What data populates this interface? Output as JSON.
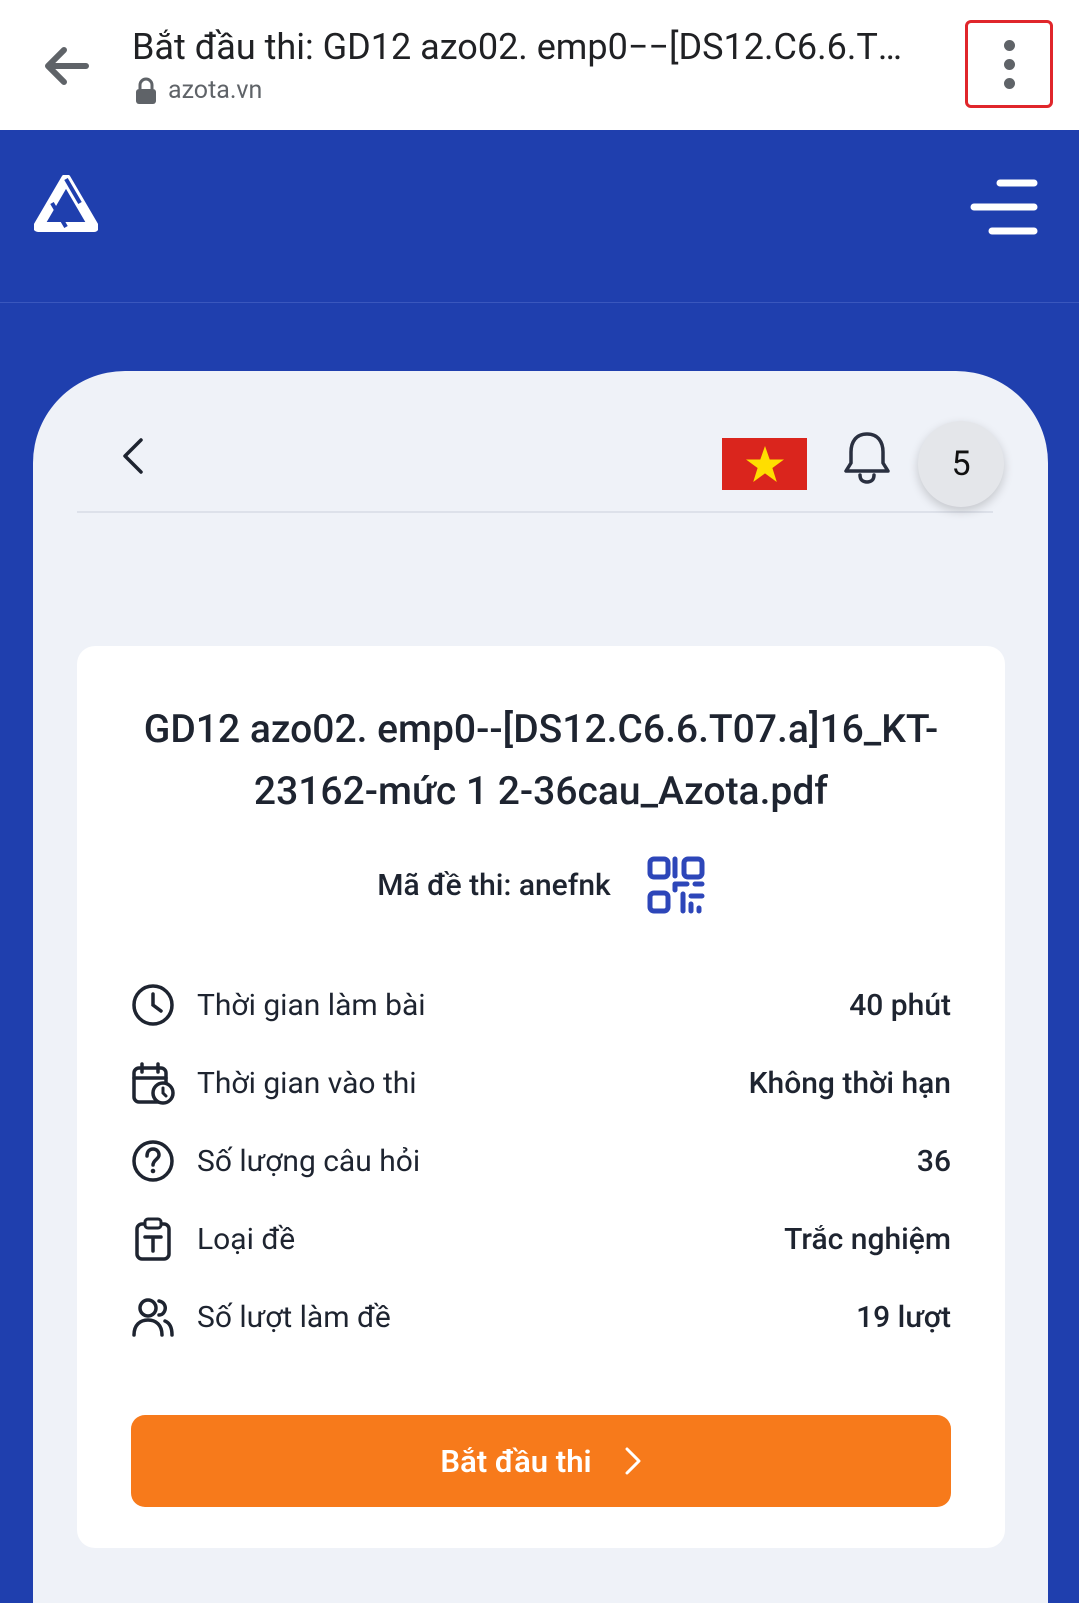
{
  "browser": {
    "title": "Bắt đầu thi: GD12 azo02. emp0−−[DS12.C6.6.T07.a]16_KT-23162-mức 1 2-36cau_Azota.pdf",
    "url": "azota.vn"
  },
  "header": {
    "logo_icon": "azota-logo-icon",
    "menu_icon": "hamburger-icon"
  },
  "panel": {
    "language_flag": "vietnam-flag-icon",
    "notification_count": "5"
  },
  "exam": {
    "title": "GD12 azo02. emp0--[DS12.C6.6.T07.a]16_KT-23162-mức 1 2-36cau_Azota.pdf",
    "code_text": "Mã đề thi: anefnk",
    "info": [
      {
        "icon": "clock-icon",
        "label": "Thời gian làm bài",
        "value": "40 phút"
      },
      {
        "icon": "calendar-clock-icon",
        "label": "Thời gian vào thi",
        "value": "Không thời hạn"
      },
      {
        "icon": "question-circle-icon",
        "label": "Số lượng câu hỏi",
        "value": "36"
      },
      {
        "icon": "clipboard-text-icon",
        "label": "Loại đề",
        "value": "Trắc nghiệm"
      },
      {
        "icon": "users-icon",
        "label": "Số lượt làm đề",
        "value": "19 lượt"
      }
    ],
    "start_button": "Bắt đầu thi"
  },
  "colors": {
    "brand_blue": "#1f3fae",
    "accent_orange": "#f77a1b",
    "qr_blue": "#2d46b9"
  }
}
